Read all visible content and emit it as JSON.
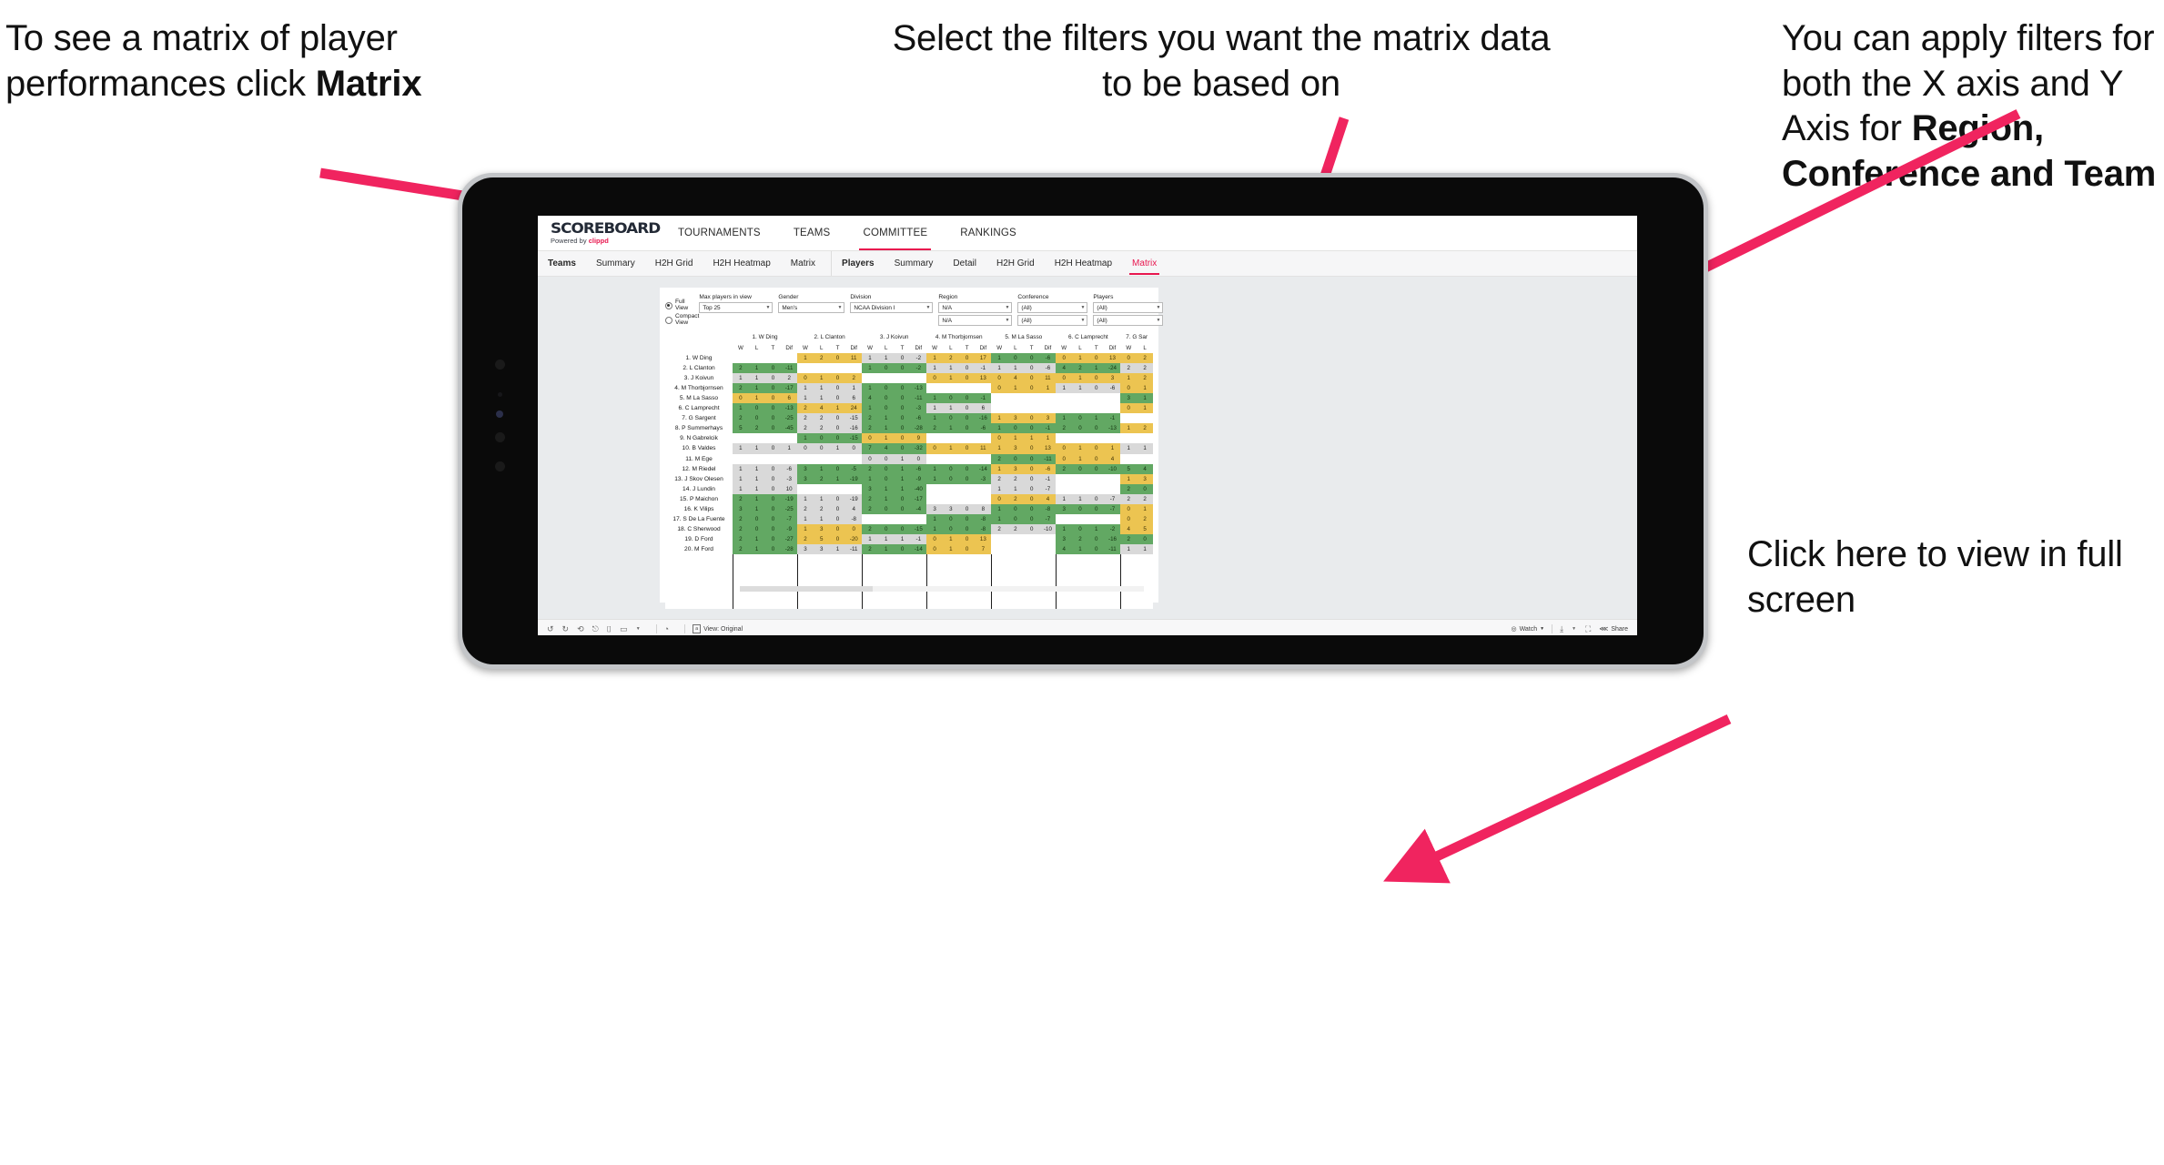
{
  "annotations": {
    "matrix_hint": {
      "lead": "To see a matrix of player performances click ",
      "bold": "Matrix"
    },
    "filters_hint": "Select the filters you want the matrix data to be based on",
    "axis_hint": {
      "lead": "You  can apply filters for both the X axis and Y Axis for ",
      "bold": "Region, Conference and Team"
    },
    "fullscreen_hint": "Click here to view in full screen"
  },
  "app": {
    "logo": {
      "title": "SCOREBOARD",
      "powered_prefix": "Powered by ",
      "powered_brand": "clippd"
    },
    "top_nav": [
      {
        "label": "TOURNAMENTS",
        "active": false
      },
      {
        "label": "TEAMS",
        "active": false
      },
      {
        "label": "COMMITTEE",
        "active": true
      },
      {
        "label": "RANKINGS",
        "active": false
      }
    ],
    "sub_nav_teams": [
      {
        "label": "Teams",
        "active": false
      },
      {
        "label": "Summary",
        "active": false
      },
      {
        "label": "H2H Grid",
        "active": false
      },
      {
        "label": "H2H Heatmap",
        "active": false
      },
      {
        "label": "Matrix",
        "active": false
      }
    ],
    "sub_nav_players": [
      {
        "label": "Players",
        "active": false
      },
      {
        "label": "Summary",
        "active": false
      },
      {
        "label": "Detail",
        "active": false
      },
      {
        "label": "H2H Grid",
        "active": false
      },
      {
        "label": "H2H Heatmap",
        "active": false
      },
      {
        "label": "Matrix",
        "active": true
      }
    ]
  },
  "filters": {
    "view_modes": [
      {
        "label": "Full View",
        "selected": true
      },
      {
        "label": "Compact View",
        "selected": false
      }
    ],
    "fields": [
      {
        "label": "Max players in view",
        "value": "Top 25"
      },
      {
        "label": "Gender",
        "value": "Men's"
      },
      {
        "label": "Division",
        "value": "NCAA Division I"
      },
      {
        "label": "Region",
        "value": "N/A",
        "value2": "N/A"
      },
      {
        "label": "Conference",
        "value": "(All)",
        "value2": "(All)"
      },
      {
        "label": "Players",
        "value": "(All)",
        "value2": "(All)"
      }
    ]
  },
  "toolbar": {
    "icons": [
      "undo-icon",
      "redo-icon",
      "revert-icon",
      "refresh-data-icon",
      "pause-icon",
      "highlight-icon"
    ],
    "view_label": "View: Original",
    "watch_label": "Watch",
    "share_label": "Share"
  },
  "matrix": {
    "sub_headers": [
      "W",
      "L",
      "T",
      "Dif"
    ],
    "columns": [
      "1. W Ding",
      "2. L Clanton",
      "3. J Koivun",
      "4. M Thorbjornsen",
      "5. M La Sasso",
      "6. C Lamprecht",
      "7. G Sar"
    ],
    "rows": [
      "1. W Ding",
      "2. L Clanton",
      "3. J Koivun",
      "4. M Thorbjornsen",
      "5. M La Sasso",
      "6. C Lamprecht",
      "7. G Sargent",
      "8. P Summerhays",
      "9. N Gabrelcik",
      "10. B Valdes",
      "11. M Ege",
      "12. M Riedel",
      "13. J Skov Olesen",
      "14. J Lundin",
      "15. P Maichon",
      "16. K Vilips",
      "17. S De La Fuente",
      "18. C Sherwood",
      "19. D Ford",
      "20. M Ford"
    ],
    "cells": [
      [
        null,
        [
          "1",
          "2",
          "0",
          "11",
          "y"
        ],
        [
          "1",
          "1",
          "0",
          "-2",
          "n"
        ],
        [
          "1",
          "2",
          "0",
          "17",
          "y"
        ],
        [
          "1",
          "0",
          "0",
          "-6",
          "g"
        ],
        [
          "0",
          "1",
          "0",
          "13",
          "y"
        ],
        [
          "0",
          "2",
          "",
          "",
          "y"
        ]
      ],
      [
        [
          "2",
          "1",
          "0",
          "-11",
          "g"
        ],
        null,
        [
          "1",
          "0",
          "0",
          "-2",
          "g"
        ],
        [
          "1",
          "1",
          "0",
          "-1",
          "n"
        ],
        [
          "1",
          "1",
          "0",
          "-6",
          "n"
        ],
        [
          "4",
          "2",
          "1",
          "-24",
          "g"
        ],
        [
          "2",
          "2",
          "",
          "",
          "n"
        ]
      ],
      [
        [
          "1",
          "1",
          "0",
          "2",
          "n"
        ],
        [
          "0",
          "1",
          "0",
          "2",
          "y"
        ],
        null,
        [
          "0",
          "1",
          "0",
          "13",
          "y"
        ],
        [
          "0",
          "4",
          "0",
          "11",
          "y"
        ],
        [
          "0",
          "1",
          "0",
          "3",
          "y"
        ],
        [
          "1",
          "2",
          "",
          "",
          "y"
        ]
      ],
      [
        [
          "2",
          "1",
          "0",
          "-17",
          "g"
        ],
        [
          "1",
          "1",
          "0",
          "1",
          "n"
        ],
        [
          "1",
          "0",
          "0",
          "-13",
          "g"
        ],
        null,
        [
          "0",
          "1",
          "0",
          "1",
          "y"
        ],
        [
          "1",
          "1",
          "0",
          "-6",
          "n"
        ],
        [
          "0",
          "1",
          "",
          "",
          "y"
        ]
      ],
      [
        [
          "0",
          "1",
          "0",
          "6",
          "y"
        ],
        [
          "1",
          "1",
          "0",
          "6",
          "n"
        ],
        [
          "4",
          "0",
          "0",
          "-11",
          "g"
        ],
        [
          "1",
          "0",
          "0",
          "-1",
          "g"
        ],
        null,
        null,
        [
          "3",
          "1",
          "",
          "",
          "g"
        ]
      ],
      [
        [
          "1",
          "0",
          "0",
          "-13",
          "g"
        ],
        [
          "2",
          "4",
          "1",
          "24",
          "y"
        ],
        [
          "1",
          "0",
          "0",
          "-3",
          "g"
        ],
        [
          "1",
          "1",
          "0",
          "6",
          "n"
        ],
        null,
        null,
        [
          "0",
          "1",
          "",
          "",
          "y"
        ]
      ],
      [
        [
          "2",
          "0",
          "0",
          "-25",
          "g"
        ],
        [
          "2",
          "2",
          "0",
          "-15",
          "n"
        ],
        [
          "2",
          "1",
          "0",
          "-6",
          "g"
        ],
        [
          "1",
          "0",
          "0",
          "-16",
          "g"
        ],
        [
          "1",
          "3",
          "0",
          "3",
          "y"
        ],
        [
          "1",
          "0",
          "1",
          "-1",
          "g"
        ],
        null
      ],
      [
        [
          "5",
          "2",
          "0",
          "-45",
          "g"
        ],
        [
          "2",
          "2",
          "0",
          "-16",
          "n"
        ],
        [
          "2",
          "1",
          "0",
          "-28",
          "g"
        ],
        [
          "2",
          "1",
          "0",
          "-6",
          "g"
        ],
        [
          "1",
          "0",
          "0",
          "-1",
          "g"
        ],
        [
          "2",
          "0",
          "0",
          "-13",
          "g"
        ],
        [
          "1",
          "2",
          "",
          "",
          "y"
        ]
      ],
      [
        null,
        [
          "1",
          "0",
          "0",
          "-15",
          "g"
        ],
        [
          "0",
          "1",
          "0",
          "9",
          "y"
        ],
        null,
        [
          "0",
          "1",
          "1",
          "1",
          "y"
        ],
        null,
        null
      ],
      [
        [
          "1",
          "1",
          "0",
          "1",
          "n"
        ],
        [
          "0",
          "0",
          "1",
          "0",
          "n"
        ],
        [
          "7",
          "4",
          "0",
          "-32",
          "g"
        ],
        [
          "0",
          "1",
          "0",
          "11",
          "y"
        ],
        [
          "1",
          "3",
          "0",
          "13",
          "y"
        ],
        [
          "0",
          "1",
          "0",
          "1",
          "y"
        ],
        [
          "1",
          "1",
          "",
          "",
          "n"
        ]
      ],
      [
        null,
        null,
        [
          "0",
          "0",
          "1",
          "0",
          "n"
        ],
        null,
        [
          "2",
          "0",
          "0",
          "-11",
          "g"
        ],
        [
          "0",
          "1",
          "0",
          "4",
          "y"
        ],
        null
      ],
      [
        [
          "1",
          "1",
          "0",
          "-6",
          "n"
        ],
        [
          "3",
          "1",
          "0",
          "-5",
          "g"
        ],
        [
          "2",
          "0",
          "1",
          "-6",
          "g"
        ],
        [
          "1",
          "0",
          "0",
          "-14",
          "g"
        ],
        [
          "1",
          "3",
          "0",
          "-6",
          "y"
        ],
        [
          "2",
          "0",
          "0",
          "-10",
          "g"
        ],
        [
          "5",
          "4",
          "",
          "",
          "g"
        ]
      ],
      [
        [
          "1",
          "1",
          "0",
          "-3",
          "n"
        ],
        [
          "3",
          "2",
          "1",
          "-19",
          "g"
        ],
        [
          "1",
          "0",
          "1",
          "-9",
          "g"
        ],
        [
          "1",
          "0",
          "0",
          "-3",
          "g"
        ],
        [
          "2",
          "2",
          "0",
          "-1",
          "n"
        ],
        null,
        [
          "1",
          "3",
          "",
          "",
          "y"
        ]
      ],
      [
        [
          "1",
          "1",
          "0",
          "10",
          "n"
        ],
        null,
        [
          "3",
          "1",
          "1",
          "-40",
          "g"
        ],
        null,
        [
          "1",
          "1",
          "0",
          "-7",
          "n"
        ],
        null,
        [
          "2",
          "0",
          "",
          "",
          "g"
        ]
      ],
      [
        [
          "2",
          "1",
          "0",
          "-19",
          "g"
        ],
        [
          "1",
          "1",
          "0",
          "-19",
          "n"
        ],
        [
          "2",
          "1",
          "0",
          "-17",
          "g"
        ],
        null,
        [
          "0",
          "2",
          "0",
          "4",
          "y"
        ],
        [
          "1",
          "1",
          "0",
          "-7",
          "n"
        ],
        [
          "2",
          "2",
          "",
          "",
          "n"
        ]
      ],
      [
        [
          "3",
          "1",
          "0",
          "-25",
          "g"
        ],
        [
          "2",
          "2",
          "0",
          "4",
          "n"
        ],
        [
          "2",
          "0",
          "0",
          "-4",
          "g"
        ],
        [
          "3",
          "3",
          "0",
          "8",
          "n"
        ],
        [
          "1",
          "0",
          "0",
          "-8",
          "g"
        ],
        [
          "3",
          "0",
          "0",
          "-7",
          "g"
        ],
        [
          "0",
          "1",
          "",
          "",
          "y"
        ]
      ],
      [
        [
          "2",
          "0",
          "0",
          "-7",
          "g"
        ],
        [
          "1",
          "1",
          "0",
          "-8",
          "n"
        ],
        null,
        [
          "1",
          "0",
          "0",
          "-8",
          "g"
        ],
        [
          "1",
          "0",
          "0",
          "-7",
          "g"
        ],
        null,
        [
          "0",
          "2",
          "",
          "",
          "y"
        ]
      ],
      [
        [
          "2",
          "0",
          "0",
          "-9",
          "g"
        ],
        [
          "1",
          "3",
          "0",
          "0",
          "y"
        ],
        [
          "2",
          "0",
          "0",
          "-15",
          "g"
        ],
        [
          "1",
          "0",
          "0",
          "-8",
          "g"
        ],
        [
          "2",
          "2",
          "0",
          "-10",
          "n"
        ],
        [
          "1",
          "0",
          "1",
          "-2",
          "g"
        ],
        [
          "4",
          "5",
          "",
          "",
          "y"
        ]
      ],
      [
        [
          "2",
          "1",
          "0",
          "-27",
          "g"
        ],
        [
          "2",
          "5",
          "0",
          "-20",
          "y"
        ],
        [
          "1",
          "1",
          "1",
          "-1",
          "n"
        ],
        [
          "0",
          "1",
          "0",
          "13",
          "y"
        ],
        null,
        [
          "3",
          "2",
          "0",
          "-16",
          "g"
        ],
        [
          "2",
          "0",
          "",
          "",
          "g"
        ]
      ],
      [
        [
          "2",
          "1",
          "0",
          "-28",
          "g"
        ],
        [
          "3",
          "3",
          "1",
          "-11",
          "n"
        ],
        [
          "2",
          "1",
          "0",
          "-14",
          "g"
        ],
        [
          "0",
          "1",
          "0",
          "7",
          "y"
        ],
        null,
        [
          "4",
          "1",
          "0",
          "-11",
          "g"
        ],
        [
          "1",
          "1",
          "",
          "",
          "n"
        ]
      ]
    ]
  },
  "colors": {
    "accent": "#e8174f",
    "win_green": "#62a863",
    "loss_yellow": "#ecc451",
    "neutral_grey": "#d9d9d9"
  }
}
